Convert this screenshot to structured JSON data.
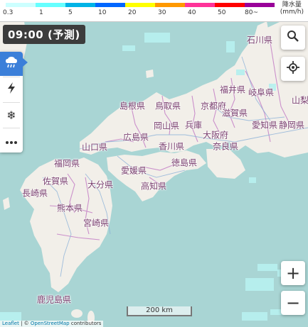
{
  "legend": {
    "title_line1": "降水量",
    "title_line2": "(mm/h)",
    "ticks": [
      "0.3",
      "1",
      "5",
      "10",
      "20",
      "30",
      "40",
      "50",
      "80~"
    ],
    "colors": [
      "#ccffff",
      "#66ffff",
      "#00b3e6",
      "#0066ff",
      "#ffff00",
      "#ff9900",
      "#ff3399",
      "#ff0000",
      "#990099"
    ]
  },
  "time_badge": "09:00 (予測)",
  "side_panel": {
    "items": [
      {
        "icon": "rain-cloud-icon",
        "active": true
      },
      {
        "icon": "lightning-icon",
        "active": false
      },
      {
        "icon": "snowflake-icon",
        "active": false
      },
      {
        "icon": "more-icon",
        "active": false
      }
    ],
    "accent_color": "#3b7fd9"
  },
  "controls": {
    "search_icon": "search-icon",
    "locate_icon": "locate-icon",
    "zoom_in": "+",
    "zoom_out": "−"
  },
  "scale_label": "200 km",
  "attribution": {
    "leaflet": "Leaflet",
    "separator": " | © ",
    "osm": "OpenStreetMap",
    "suffix": " contributors"
  },
  "prefectures": [
    "石川県",
    "岐阜県",
    "福井県",
    "京都府",
    "滋賀県",
    "山梨",
    "愛知県",
    "静岡県",
    "島根県",
    "鳥取県",
    "岡山県",
    "広島県",
    "大阪府",
    "奈良県",
    "兵庫",
    "山口県",
    "香川県",
    "徳島県",
    "愛媛県",
    "高知県",
    "福岡県",
    "佐賀県",
    "大分県",
    "長崎県",
    "熊本県",
    "宮崎県",
    "鹿児島県"
  ]
}
